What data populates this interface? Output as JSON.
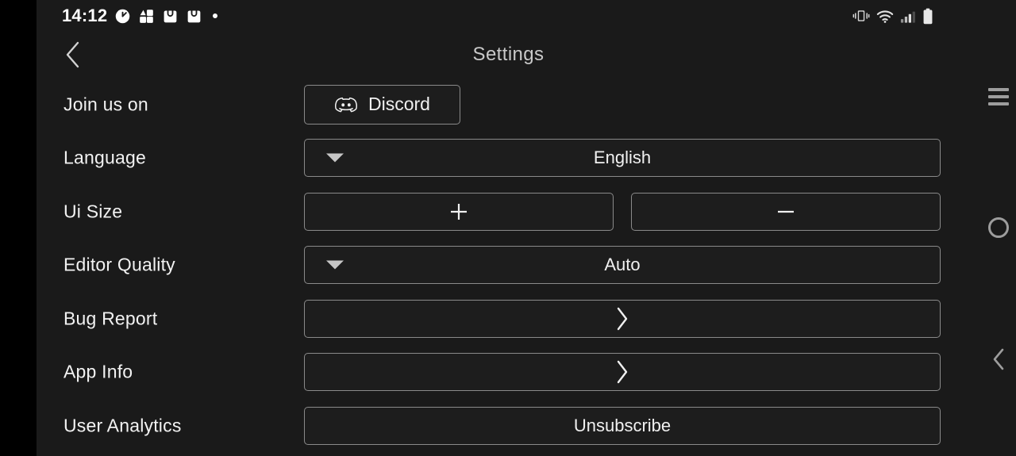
{
  "statusbar": {
    "time": "14:12",
    "left_icons": [
      "timer-icon",
      "puzzle-icon",
      "shopping-bag-icon",
      "shopping-bag-icon",
      "dot-icon"
    ],
    "right_icons": [
      "vibrate-icon",
      "wifi-icon",
      "cell-signal-icon",
      "battery-icon"
    ]
  },
  "header": {
    "back_icon": "chevron-left-icon",
    "title": "Settings"
  },
  "rows": [
    {
      "label": "Join us on",
      "controls": [
        {
          "kind": "discord",
          "label": "Discord",
          "icon": "discord-logo-icon"
        }
      ]
    },
    {
      "label": "Language",
      "controls": [
        {
          "kind": "dropdown",
          "label": "English",
          "icon": "triangle-down-icon"
        }
      ]
    },
    {
      "label": "Ui Size",
      "controls": [
        {
          "kind": "icon-half",
          "label": "",
          "icon": "plus-icon"
        },
        {
          "kind": "icon-half",
          "label": "",
          "icon": "minus-icon"
        }
      ]
    },
    {
      "label": "Editor Quality",
      "controls": [
        {
          "kind": "dropdown",
          "label": "Auto",
          "icon": "triangle-down-icon"
        }
      ]
    },
    {
      "label": "Bug Report",
      "controls": [
        {
          "kind": "icon-full",
          "label": "",
          "icon": "chevron-right-icon"
        }
      ]
    },
    {
      "label": "App Info",
      "controls": [
        {
          "kind": "icon-full",
          "label": "",
          "icon": "chevron-right-icon"
        }
      ]
    },
    {
      "label": "User Analytics",
      "controls": [
        {
          "kind": "text-full",
          "label": "Unsubscribe",
          "icon": ""
        }
      ]
    }
  ],
  "navbar": {
    "recents_icon": "hamburger-recents-icon",
    "home_icon": "home-circle-icon",
    "back_icon": "chevron-left-icon"
  },
  "colors": {
    "background": "#1a1a1a",
    "gutter": "#000000",
    "border": "#8a8a8a",
    "label_text": "#f2f2f2",
    "title_text": "#c9c9c9",
    "nav_icon": "#9d9d9d"
  }
}
